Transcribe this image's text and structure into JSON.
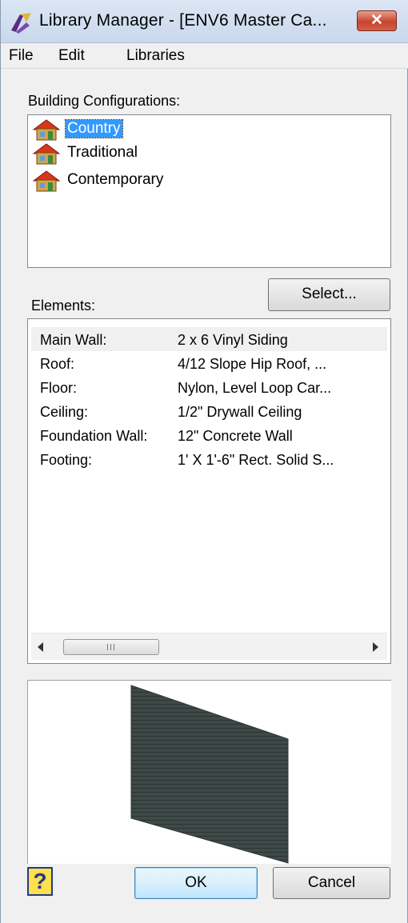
{
  "window": {
    "title": "Library Manager - [ENV6 Master Ca...",
    "close_label": "✕"
  },
  "menu": {
    "items": [
      "File",
      "Edit",
      "Libraries"
    ]
  },
  "configurations": {
    "label": "Building Configurations:",
    "items": [
      "Country",
      "Traditional",
      "Contemporary"
    ],
    "selected": "Country"
  },
  "select_button": "Select...",
  "elements": {
    "label": "Elements:",
    "rows": [
      {
        "name": "Main Wall:",
        "value": "2 x 6 Vinyl Siding"
      },
      {
        "name": "Roof:",
        "value": "4/12 Slope Hip Roof, ..."
      },
      {
        "name": "Floor:",
        "value": "Nylon, Level Loop Car..."
      },
      {
        "name": "Ceiling:",
        "value": "1/2\" Drywall Ceiling"
      },
      {
        "name": "Foundation Wall:",
        "value": "12\" Concrete Wall"
      },
      {
        "name": "Footing:",
        "value": "1' X 1'-6\" Rect. Solid S..."
      }
    ],
    "scrollbar_grip": "III"
  },
  "buttons": {
    "help": "?",
    "ok": "OK",
    "cancel": "Cancel"
  },
  "colors": {
    "selection": "#3399ff",
    "wall": "#3f4a48"
  }
}
